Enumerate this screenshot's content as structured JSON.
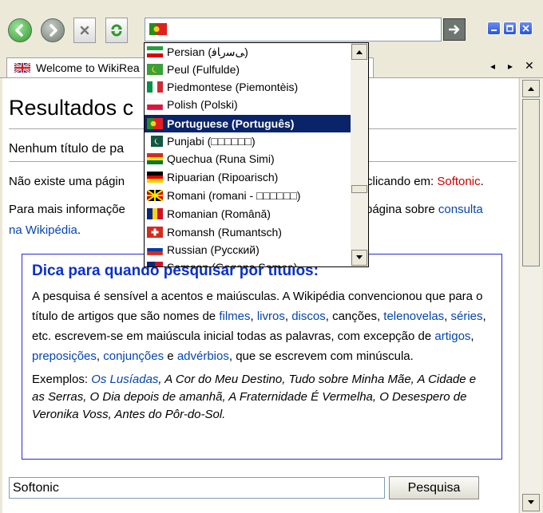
{
  "toolbar": {
    "back_icon": "back-arrow-icon",
    "forward_icon": "forward-arrow-icon",
    "stop_icon": "stop-icon",
    "refresh_icon": "refresh-icon",
    "go_icon": "go-arrow-icon",
    "language_flag": "portugal-flag"
  },
  "tab": {
    "label": "Welcome to WikiRea",
    "icon": "uk-flag",
    "prev": "◂",
    "next": "▸",
    "close": "✕"
  },
  "dropdown": {
    "items": [
      {
        "label": "Persian (ﯽﺳﺭﺎﻓ)",
        "flag": "iran-flag"
      },
      {
        "label": "Peul (Fulfulde)",
        "flag": "senegal-flag"
      },
      {
        "label": "Piedmontese (Piemontèis)",
        "flag": "italy-flag"
      },
      {
        "label": "Polish (Polski)",
        "flag": "poland-flag"
      },
      {
        "label": "Portuguese (Português)",
        "flag": "portugal-flag",
        "selected": true
      },
      {
        "label": "Punjabi (□□□□□□)",
        "flag": "pakistan-flag"
      },
      {
        "label": "Quechua (Runa Simi)",
        "flag": "bolivia-flag"
      },
      {
        "label": "Ripuarian (Ripoarisch)",
        "flag": "germany-flag"
      },
      {
        "label": "Romani (romani - □□□□□□)",
        "flag": "macedonia-flag"
      },
      {
        "label": "Romanian (Română)",
        "flag": "romania-flag"
      },
      {
        "label": "Romansh (Rumantsch)",
        "flag": "switzerland-flag"
      },
      {
        "label": "Russian (Русский)",
        "flag": "russia-flag"
      },
      {
        "label": "Samoan (Gagana Samoa)",
        "flag": "samoa-flag"
      }
    ]
  },
  "page": {
    "title": "Resultados c",
    "subtitle": "Nenhum título de pa",
    "p1_start": "Não existe uma págin",
    "p1_end": " clicando em: ",
    "p1_link": "Softonic",
    "p1_tail": ".",
    "p2_start": "Para mais informaçõe",
    "p2_mid": "página sobre ",
    "p2_link1": "consulta",
    "p2_link2": "na Wikipédia",
    "p2_tail": "."
  },
  "tip": {
    "heading": "Dica para quando pesquisar por títulos:",
    "t1": "A pesquisa é sensível a acentos e maiúsculas. A Wikipédia convencionou que para o título de artigos que são nomes de ",
    "l_filmes": "filmes",
    "s1": ", ",
    "l_livros": "livros",
    "s2": ", ",
    "l_discos": "discos",
    "t2": ", canções, ",
    "l_telenovelas": "telenovelas",
    "s3": ", ",
    "l_series": "séries",
    "t3": ", etc. escrevem-se em maiúscula inicial todas as palavras, com excepção de ",
    "l_artigos": "artigos",
    "s4": ", ",
    "l_preposicoes": "preposições",
    "s5": ", ",
    "l_conjuncoes": "conjunções",
    "t4": " e ",
    "l_adverbios": "advérbios",
    "t5": ", que se escrevem com minúscula.",
    "ex_label": "Exemplos: ",
    "ex_link": "Os Lusíadas",
    "ex_rest": ", A Cor do Meu Destino, Tudo sobre Minha Mãe, A Cidade e as Serras, O Dia depois de amanhã, A Fraternidade É Vermelha, O Desespero de Veronika Voss, Antes do Pôr-do-Sol."
  },
  "search": {
    "value": "Softonic",
    "button": "Pesquisa"
  }
}
